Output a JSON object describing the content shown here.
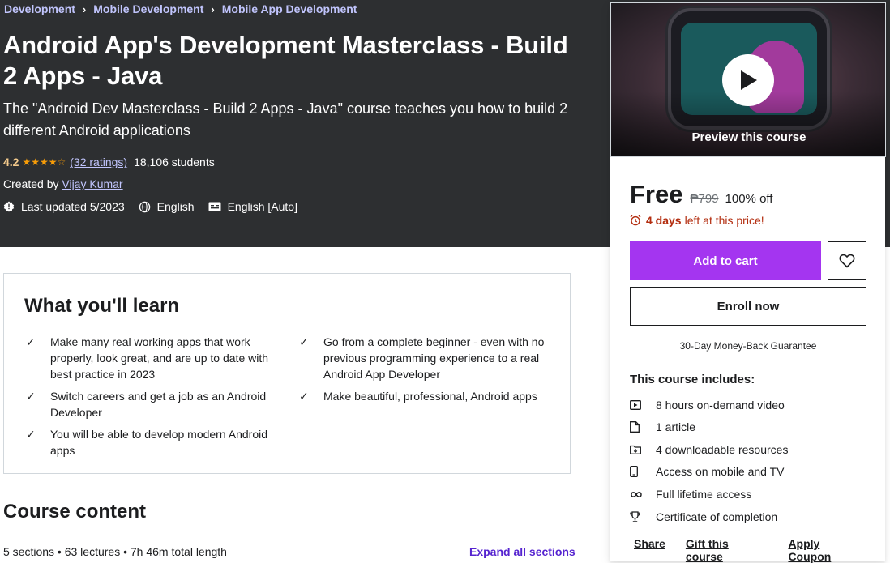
{
  "breadcrumb": [
    "Development",
    "Mobile Development",
    "Mobile App Development"
  ],
  "course": {
    "title": "Android App's Development Masterclass - Build 2 Apps - Java",
    "subtitle": "The \"Android Dev Masterclass - Build 2 Apps - Java\" course teaches you how to build 2 different Android applications",
    "rating": "4.2",
    "stars_value": 4.2,
    "stars": "★★★★☆",
    "ratings_count": "(32 ratings)",
    "students": "18,106 students",
    "created_by_label": "Created by",
    "instructor": "Vijay Kumar",
    "last_updated": "Last updated 5/2023",
    "language": "English",
    "captions": "English [Auto]"
  },
  "learn": {
    "title": "What you'll learn",
    "items": [
      "Make many real working apps that work properly, look great, and are up to date with best practice in 2023",
      "Go from a complete beginner - even with no previous programming experience to a real Android App Developer",
      "Switch careers and get a job as an Android Developer",
      "Make beautiful, professional, Android apps",
      "You will be able to develop modern Android apps"
    ]
  },
  "content": {
    "title": "Course content",
    "summary": "5 sections • 63 lectures • 7h 46m total length",
    "expand_all": "Expand all sections"
  },
  "sidebar": {
    "preview_label": "Preview this course",
    "price": "Free",
    "original_price": "₱799",
    "discount": "100% off",
    "countdown_days": "4 days",
    "countdown_rest": "left at this price!",
    "add_to_cart": "Add to cart",
    "enroll_now": "Enroll now",
    "guarantee": "30-Day Money-Back Guarantee",
    "includes_title": "This course includes:",
    "includes": [
      {
        "icon": "video-icon",
        "label": "8 hours on-demand video"
      },
      {
        "icon": "article-icon",
        "label": "1 article"
      },
      {
        "icon": "download-folder-icon",
        "label": "4 downloadable resources"
      },
      {
        "icon": "mobile-icon",
        "label": "Access on mobile and TV"
      },
      {
        "icon": "infinity-icon",
        "label": "Full lifetime access"
      },
      {
        "icon": "trophy-icon",
        "label": "Certificate of completion"
      }
    ],
    "links": [
      "Share",
      "Gift this course",
      "Apply Coupon"
    ]
  },
  "colors": {
    "hero_bg": "#2d2f31",
    "accent_purple": "#a435f0",
    "link_purple": "#5624d0",
    "breadcrumb": "#c0c4fc",
    "rating_gold": "#f3ca8c",
    "countdown_red": "#b32d0f"
  }
}
